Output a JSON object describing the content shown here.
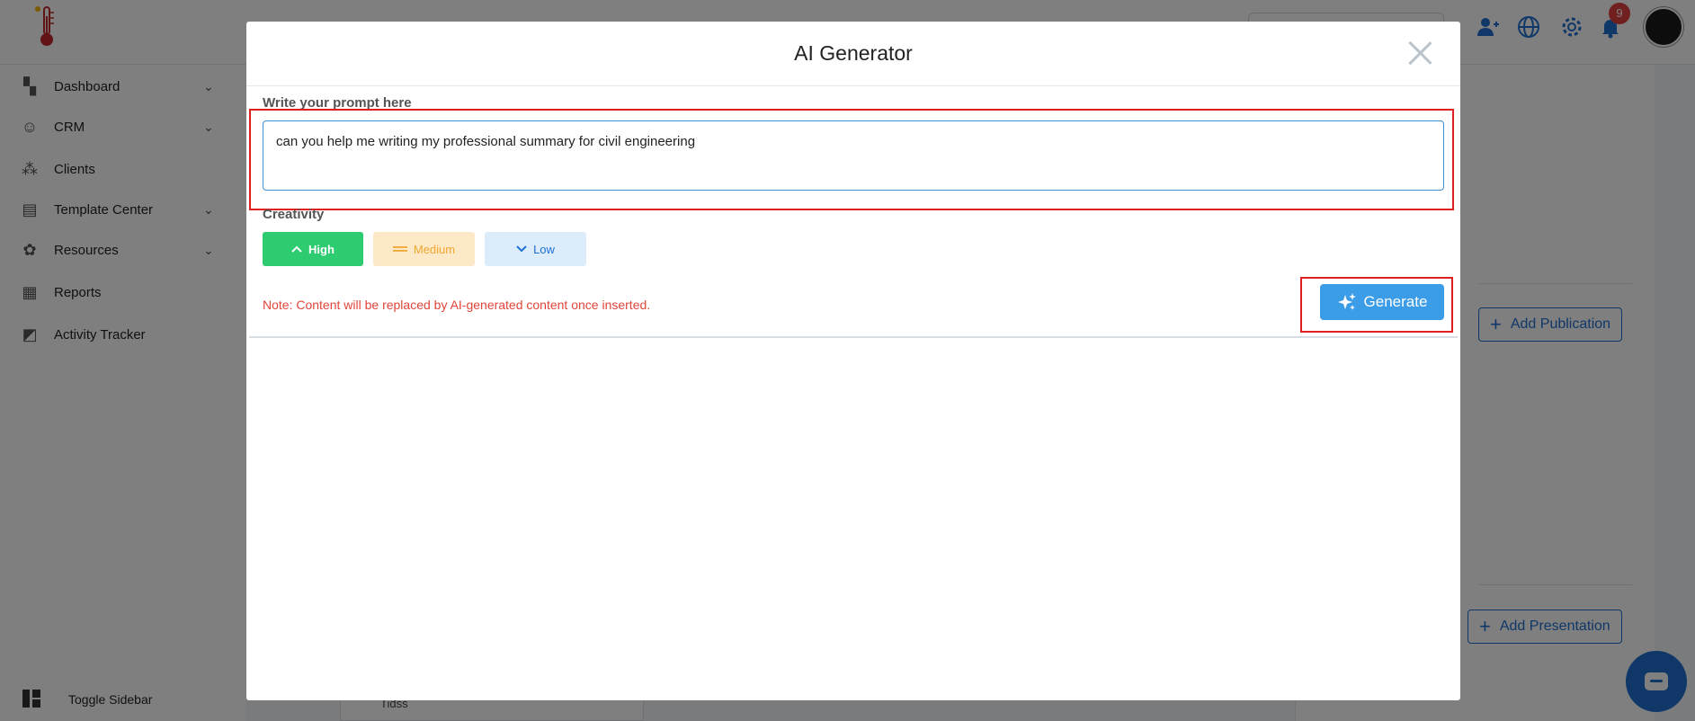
{
  "app": {
    "sidebar": {
      "items": [
        {
          "label": "Dashboard",
          "icon": "dashboard-icon",
          "has_chevron": true
        },
        {
          "label": "CRM",
          "icon": "crm-icon",
          "has_chevron": true
        },
        {
          "label": "Clients",
          "icon": "clients-icon",
          "has_chevron": false
        },
        {
          "label": "Template Center",
          "icon": "template-icon",
          "has_chevron": true
        },
        {
          "label": "Resources",
          "icon": "resources-icon",
          "has_chevron": true
        },
        {
          "label": "Reports",
          "icon": "reports-icon",
          "has_chevron": false
        },
        {
          "label": "Activity Tracker",
          "icon": "activity-icon",
          "has_chevron": false
        }
      ],
      "toggle_label": "Toggle Sidebar"
    },
    "topbar": {
      "notification_count": "9"
    },
    "content": {
      "add_publication": "Add Publication",
      "add_presentation": "Add Presentation",
      "partial_item": "Tidss"
    }
  },
  "modal": {
    "title": "AI Generator",
    "prompt_label": "Write your prompt here",
    "prompt_value": "can you help me writing my professional summary for civil engineering",
    "creativity_label": "Creativity",
    "creativity_options": [
      {
        "label": "High",
        "icon": "chevron-up-icon",
        "selected": true
      },
      {
        "label": "Medium",
        "icon": "equals-icon",
        "selected": false
      },
      {
        "label": "Low",
        "icon": "chevron-down-icon",
        "selected": false
      }
    ],
    "note": "Note: Content will be replaced by AI-generated content once inserted.",
    "generate_label": "Generate"
  },
  "colors": {
    "accent": "#1f6fd1",
    "generate_button": "#3b9ce8",
    "high": "#2ecc71",
    "medium_bg": "#fde8c8",
    "low_bg": "#dcecfb",
    "note": "#e0453a",
    "highlight_box": "#e02020",
    "badge": "#e34141"
  }
}
